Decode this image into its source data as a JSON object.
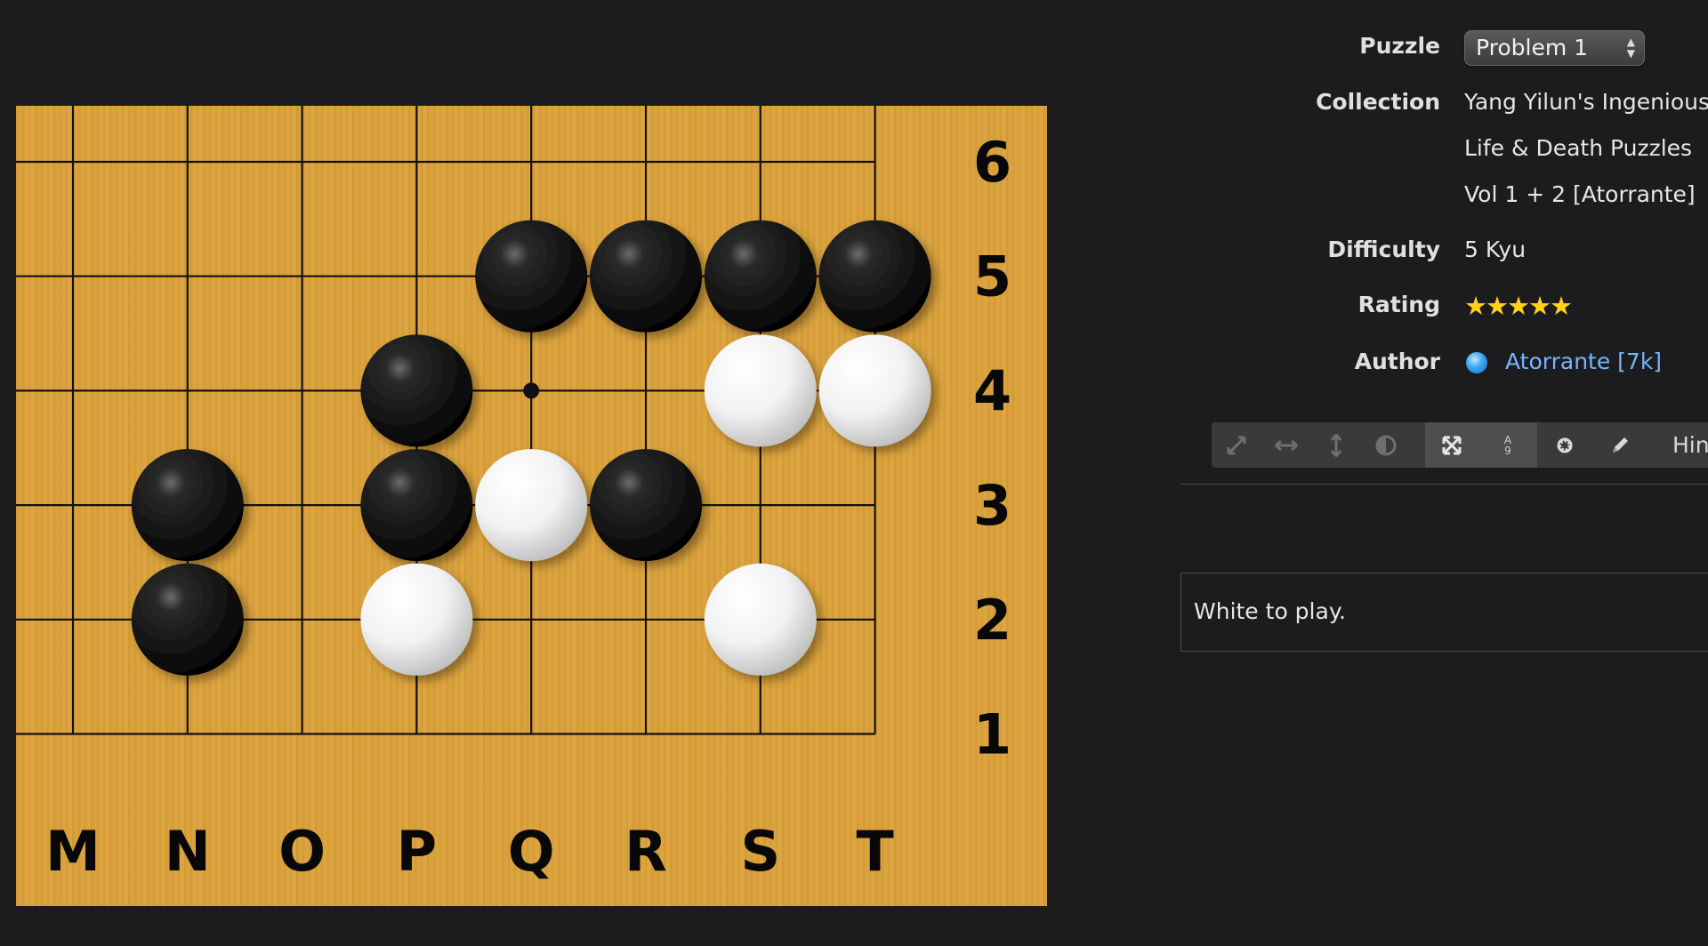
{
  "board": {
    "columns": [
      "M",
      "N",
      "O",
      "P",
      "Q",
      "R",
      "S",
      "T"
    ],
    "rows": [
      "6",
      "5",
      "4",
      "3",
      "2",
      "1"
    ],
    "star_points": [
      {
        "col": "Q",
        "row": "4"
      }
    ],
    "stones": [
      {
        "color": "black",
        "col": "Q",
        "row": "5"
      },
      {
        "color": "black",
        "col": "R",
        "row": "5"
      },
      {
        "color": "black",
        "col": "S",
        "row": "5"
      },
      {
        "color": "black",
        "col": "T",
        "row": "5"
      },
      {
        "color": "black",
        "col": "P",
        "row": "4"
      },
      {
        "color": "white",
        "col": "S",
        "row": "4"
      },
      {
        "color": "white",
        "col": "T",
        "row": "4"
      },
      {
        "color": "black",
        "col": "N",
        "row": "3"
      },
      {
        "color": "black",
        "col": "P",
        "row": "3"
      },
      {
        "color": "white",
        "col": "Q",
        "row": "3"
      },
      {
        "color": "black",
        "col": "R",
        "row": "3"
      },
      {
        "color": "black",
        "col": "N",
        "row": "2"
      },
      {
        "color": "white",
        "col": "P",
        "row": "2"
      },
      {
        "color": "white",
        "col": "S",
        "row": "2"
      }
    ]
  },
  "info": {
    "puzzle_label": "Puzzle",
    "puzzle_value": "Problem 1",
    "collection_label": "Collection",
    "collection_lines": [
      "Yang Yilun's Ingenious",
      "Life & Death Puzzles",
      "Vol 1 + 2 [Atorrante]"
    ],
    "difficulty_label": "Difficulty",
    "difficulty_value": "5 Kyu",
    "rating_label": "Rating",
    "rating_stars": "★★★★★",
    "rating_value": 5,
    "author_label": "Author",
    "author_name": "Atorrante [7k]"
  },
  "toolbar": {
    "icons": [
      "expand-diagonal-icon",
      "expand-horizontal-icon",
      "expand-vertical-icon",
      "contrast-icon",
      "shuffle-icon",
      "coordinates-icon",
      "gear-icon",
      "pencil-icon"
    ],
    "coord_icon_top": "A",
    "coord_icon_bottom": "9",
    "hint_label": "Hint"
  },
  "message": "White to play.",
  "colors": {
    "board": "#dba23c",
    "background": "#1c1c1e",
    "link": "#74b5ff",
    "stars": "#ffd21a"
  }
}
